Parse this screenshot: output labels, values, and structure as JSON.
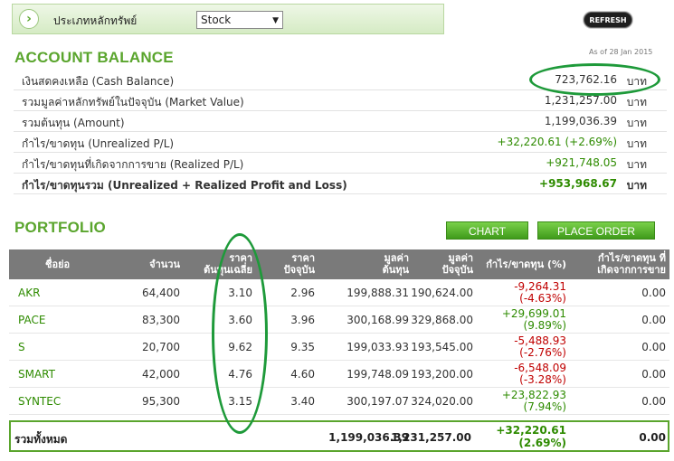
{
  "topbar": {
    "label": "ประเภทหลักทรัพย์",
    "select_value": "Stock",
    "refresh_label": "REFRESH"
  },
  "as_of": "As of 28 Jan 2015",
  "account": {
    "title": "ACCOUNT BALANCE",
    "unit": "บาท",
    "rows": [
      {
        "label": "เงินสดคงเหลือ (Cash Balance)",
        "value": "723,762.16"
      },
      {
        "label": "รวมมูลค่าหลักทรัพย์ในปัจจุบัน (Market Value)",
        "value": "1,231,257.00"
      },
      {
        "label": "รวมต้นทุน (Amount)",
        "value": "1,199,036.39"
      },
      {
        "label": "กำไร/ขาดทุน (Unrealized P/L)",
        "value": "+32,220.61 (+2.69%)"
      },
      {
        "label": "กำไร/ขาดทุนที่เกิดจากการขาย (Realized P/L)",
        "value": "+921,748.05"
      },
      {
        "label": "กำไร/ขาดทุนรวม (Unrealized + Realized Profit and Loss)",
        "value": "+953,968.67"
      }
    ]
  },
  "portfolio": {
    "title": "PORTFOLIO",
    "chart_button": "CHART",
    "order_button": "PLACE ORDER",
    "headers": {
      "symbol": "ชื่อย่อ",
      "qty": "จำนวน",
      "avg_l1": "ราคา",
      "avg_l2": "ต้นทุนเฉลี่ย",
      "mkt_l1": "ราคา",
      "mkt_l2": "ปัจจุบัน",
      "cost_l1": "มูลค่า",
      "cost_l2": "ต้นทุน",
      "mval_l1": "มูลค่า",
      "mval_l2": "ปัจจุบัน",
      "pl": "กำไร/ขาดทุน (%)",
      "rpl_l1": "กำไร/ขาดทุน ที่",
      "rpl_l2": "เกิดจากการขาย"
    },
    "rows": [
      {
        "symbol": "AKR",
        "qty": "64,400",
        "avg": "3.10",
        "mkt": "2.96",
        "cost": "199,888.31",
        "mval": "190,624.00",
        "pl": "-9,264.31",
        "pl_pct": "(-4.63%)",
        "rpl": "0.00"
      },
      {
        "symbol": "PACE",
        "qty": "83,300",
        "avg": "3.60",
        "mkt": "3.96",
        "cost": "300,168.99",
        "mval": "329,868.00",
        "pl": "+29,699.01",
        "pl_pct": "(9.89%)",
        "rpl": "0.00"
      },
      {
        "symbol": "S",
        "qty": "20,700",
        "avg": "9.62",
        "mkt": "9.35",
        "cost": "199,033.93",
        "mval": "193,545.00",
        "pl": "-5,488.93",
        "pl_pct": "(-2.76%)",
        "rpl": "0.00"
      },
      {
        "symbol": "SMART",
        "qty": "42,000",
        "avg": "4.76",
        "mkt": "4.60",
        "cost": "199,748.09",
        "mval": "193,200.00",
        "pl": "-6,548.09",
        "pl_pct": "(-3.28%)",
        "rpl": "0.00"
      },
      {
        "symbol": "SYNTEC",
        "qty": "95,300",
        "avg": "3.15",
        "mkt": "3.40",
        "cost": "300,197.07",
        "mval": "324,020.00",
        "pl": "+23,822.93",
        "pl_pct": "(7.94%)",
        "rpl": "0.00"
      }
    ],
    "total": {
      "label": "รวมทั้งหมด",
      "cost": "1,199,036.39",
      "mval": "1,231,257.00",
      "pl": "+32,220.61",
      "pl_pct": "(2.69%)",
      "rpl": "0.00"
    }
  },
  "colors": {
    "accent": "#5aa52d",
    "gain": "#2e8b00",
    "loss": "#c00000",
    "header_bg": "#7a7a7a",
    "annotation": "#1e9a3a"
  }
}
